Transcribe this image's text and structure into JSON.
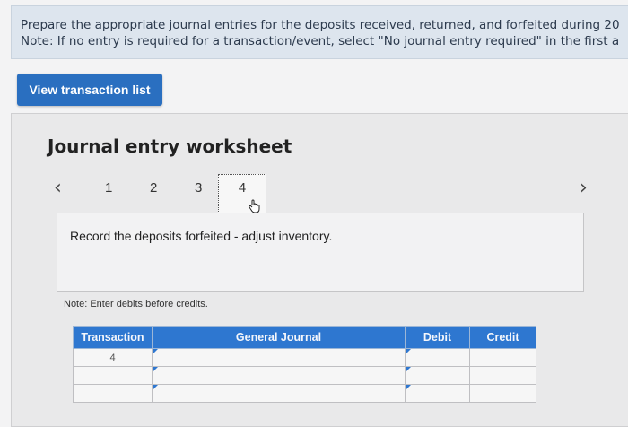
{
  "instructions": {
    "line1": "Prepare the appropriate journal entries for the deposits received, returned, and forfeited during 20",
    "line2": "Note: If no entry is required for a transaction/event, select \"No journal entry required\" in the first a"
  },
  "view_transaction_button": "View transaction list",
  "worksheet": {
    "title": "Journal entry worksheet",
    "pages": [
      "1",
      "2",
      "3",
      "4"
    ],
    "current_page": "4",
    "prev_icon": "chevron-left-icon",
    "next_icon": "chevron-right-icon",
    "record_text": "Record the deposits forfeited - adjust inventory.",
    "note": "Note: Enter debits before credits."
  },
  "journal_table": {
    "headers": [
      "Transaction",
      "General Journal",
      "Debit",
      "Credit"
    ],
    "rows": [
      {
        "transaction": "4"
      },
      {
        "transaction": ""
      },
      {
        "transaction": ""
      }
    ]
  },
  "colors": {
    "primary_button": "#2a6fc0",
    "table_header": "#2e77d0",
    "instructions_bg": "#dde5ee"
  }
}
